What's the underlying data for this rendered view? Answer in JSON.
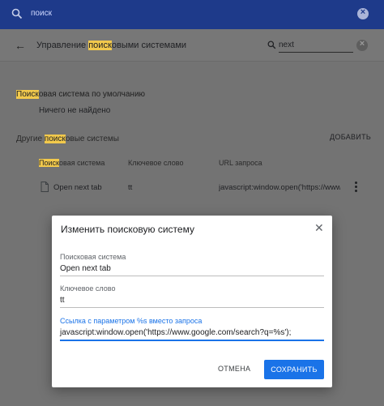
{
  "topbar": {
    "query": "поиск"
  },
  "header": {
    "title_pre": "Управление ",
    "title_hl": "поиск",
    "title_post": "овыми системами",
    "search_value": "next"
  },
  "default_section": {
    "heading_hl": "Поиск",
    "heading_rest": "овая система по умолчанию",
    "empty_text": "Ничего не найдено"
  },
  "other_section": {
    "heading_pre": "Другие ",
    "heading_hl": "поиск",
    "heading_post": "овые системы",
    "add_label": "ДОБАВИТЬ",
    "columns": {
      "name_hl": "Поиск",
      "name_rest": "овая система",
      "keyword": "Ключевое слово",
      "url": "URL запроса"
    },
    "rows": [
      {
        "name": "Open next tab",
        "keyword": "tt",
        "url": "javascript:window.open('https://www..."
      }
    ]
  },
  "dialog": {
    "title": "Изменить поисковую систему",
    "fields": [
      {
        "label": "Поисковая система",
        "value": "Open next tab"
      },
      {
        "label": "Ключевое слово",
        "value": "tt"
      },
      {
        "label": "Ссылка с параметром %s вместо запроса",
        "value": "javascript:window.open('https://www.google.com/search?q=%s');"
      }
    ],
    "cancel_label": "ОТМЕНА",
    "save_label": "СОХРАНИТЬ"
  },
  "colors": {
    "topbar": "#1e3a8a",
    "highlight": "#f2c94c",
    "accent": "#1a73e8",
    "overlay_bg": "#737373"
  },
  "icons": [
    "search-icon",
    "clear-icon",
    "back-arrow-icon",
    "file-icon",
    "more-vert-icon",
    "close-icon"
  ]
}
